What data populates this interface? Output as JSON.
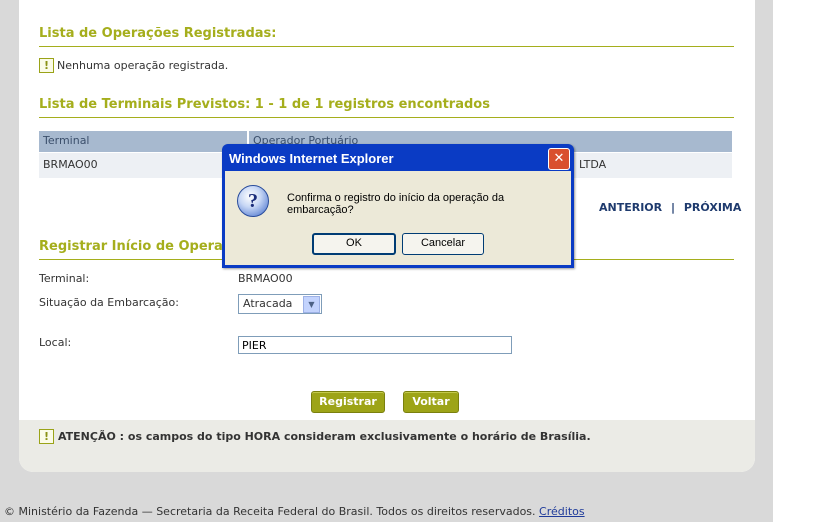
{
  "operations": {
    "title": "Lista de Operações Registradas:",
    "empty_message": "Nenhuma operação registrada."
  },
  "terminals": {
    "title": "Lista de Terminais Previstos: 1 - 1 de 1 registros encontrados",
    "columns": [
      "Terminal",
      "Operador Portuário"
    ],
    "rows": [
      [
        "BRMAO00",
        "LTDA"
      ]
    ],
    "pager_prev": "ANTERIOR",
    "pager_sep": "|",
    "pager_next": "PRÓXIMA"
  },
  "register": {
    "title": "Registrar Início de Operação",
    "terminal_label": "Terminal:",
    "terminal_value": "BRMAO00",
    "situation_label": "Situação da Embarcação:",
    "situation_value": "Atracada",
    "local_label": "Local:",
    "local_value": "PIER",
    "register_button": "Registrar",
    "back_button": "Voltar"
  },
  "attention": {
    "label": "ATENÇÃO :",
    "text": "os campos do tipo HORA consideram exclusivamente o horário de Brasília."
  },
  "footer": {
    "text": "© Ministério da Fazenda — Secretaria da Receita Federal do Brasil. Todos os direitos reservados.",
    "link": "Créditos"
  },
  "dialog": {
    "title": "Windows Internet Explorer",
    "icon": "question-icon",
    "message": "Confirma o registro do início da operação da embarcação?",
    "ok_label": "OK",
    "cancel_label": "Cancelar"
  },
  "colors": {
    "accent": "#a5ae1c",
    "button": "#9da417",
    "dialog_title_bar": "#0a3bc4",
    "table_header": "#a7b9cf"
  }
}
